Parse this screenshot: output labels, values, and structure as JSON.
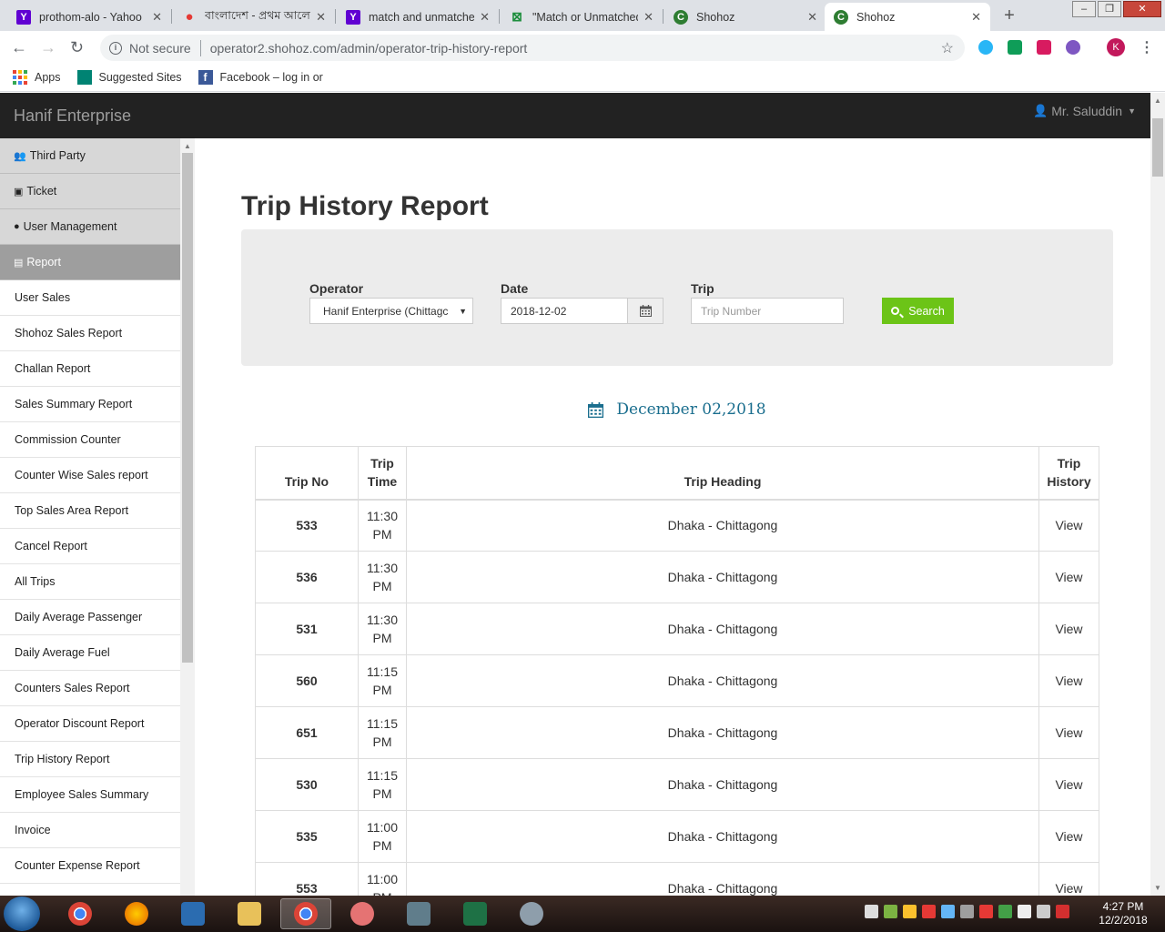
{
  "browser": {
    "tabs": [
      {
        "title": "prothom-alo - Yahoo",
        "favicon": "yahoo-icon",
        "color": "#6001d2",
        "glyph": "Y"
      },
      {
        "title": "বাংলাদেশ - প্রথম আলো",
        "favicon": "prothom-alo-icon",
        "color": "#e53935",
        "glyph": "●"
      },
      {
        "title": "match and unmatched",
        "favicon": "yahoo-icon",
        "color": "#6001d2",
        "glyph": "Y"
      },
      {
        "title": "\"Match or Unmatched",
        "favicon": "sheet-icon",
        "color": "#1e8e3e",
        "glyph": "⊠"
      },
      {
        "title": "Shohoz",
        "favicon": "shohoz-icon",
        "color": "#2e7d32",
        "glyph": "C"
      },
      {
        "title": "Shohoz",
        "favicon": "shohoz-icon",
        "color": "#2e7d32",
        "glyph": "C"
      }
    ],
    "security_label": "Not secure",
    "url": "operator2.shohoz.com/admin/operator-trip-history-report",
    "profile_initial": "K",
    "bookmarks": {
      "apps": "Apps",
      "suggested": "Suggested Sites",
      "facebook": "Facebook – log in or"
    }
  },
  "header": {
    "brand": "Hanif Enterprise",
    "user": "Mr. Saluddin"
  },
  "sidebar": {
    "sections": [
      {
        "label": "Third Party",
        "icon": "users-icon"
      },
      {
        "label": "Ticket",
        "icon": "ticket-icon"
      },
      {
        "label": "User Management",
        "icon": "user-icon"
      },
      {
        "label": "Report",
        "icon": "file-icon"
      }
    ],
    "report_items": [
      "User Sales",
      "Shohoz Sales Report",
      "Challan Report",
      "Sales Summary Report",
      "Commission Counter",
      "Counter Wise Sales report",
      "Top Sales Area Report",
      "Cancel Report",
      "All Trips",
      "Daily Average Passenger",
      "Daily Average Fuel",
      "Counters Sales Report",
      "Operator Discount Report",
      "Trip History Report",
      "Employee Sales Summary",
      "Invoice",
      "Counter Expense Report"
    ]
  },
  "main": {
    "title": "Trip History Report",
    "filters": {
      "operator_label": "Operator",
      "operator_value": "Hanif Enterprise (Chittagc",
      "date_label": "Date",
      "date_value": "2018-12-02",
      "trip_label": "Trip",
      "trip_placeholder": "Trip Number",
      "search_label": "Search"
    },
    "date_heading": "December 02,2018",
    "table": {
      "headers": {
        "trip_no": "Trip No",
        "trip_time_1": "Trip",
        "trip_time_2": "Time",
        "heading": "Trip Heading",
        "history_1": "Trip",
        "history_2": "History"
      },
      "rows": [
        {
          "no": "533",
          "time_1": "11:30",
          "time_2": "PM",
          "heading": "Dhaka - Chittagong",
          "action": "View"
        },
        {
          "no": "536",
          "time_1": "11:30",
          "time_2": "PM",
          "heading": "Dhaka - Chittagong",
          "action": "View"
        },
        {
          "no": "531",
          "time_1": "11:30",
          "time_2": "PM",
          "heading": "Dhaka - Chittagong",
          "action": "View"
        },
        {
          "no": "560",
          "time_1": "11:15",
          "time_2": "PM",
          "heading": "Dhaka - Chittagong",
          "action": "View"
        },
        {
          "no": "651",
          "time_1": "11:15",
          "time_2": "PM",
          "heading": "Dhaka - Chittagong",
          "action": "View"
        },
        {
          "no": "530",
          "time_1": "11:15",
          "time_2": "PM",
          "heading": "Dhaka - Chittagong",
          "action": "View"
        },
        {
          "no": "535",
          "time_1": "11:00",
          "time_2": "PM",
          "heading": "Dhaka - Chittagong",
          "action": "View"
        },
        {
          "no": "553",
          "time_1": "11:00",
          "time_2": "PM",
          "heading": "Dhaka - Chittagong",
          "action": "View"
        }
      ]
    }
  },
  "taskbar": {
    "time": "4:27 PM",
    "date": "12/2/2018"
  }
}
